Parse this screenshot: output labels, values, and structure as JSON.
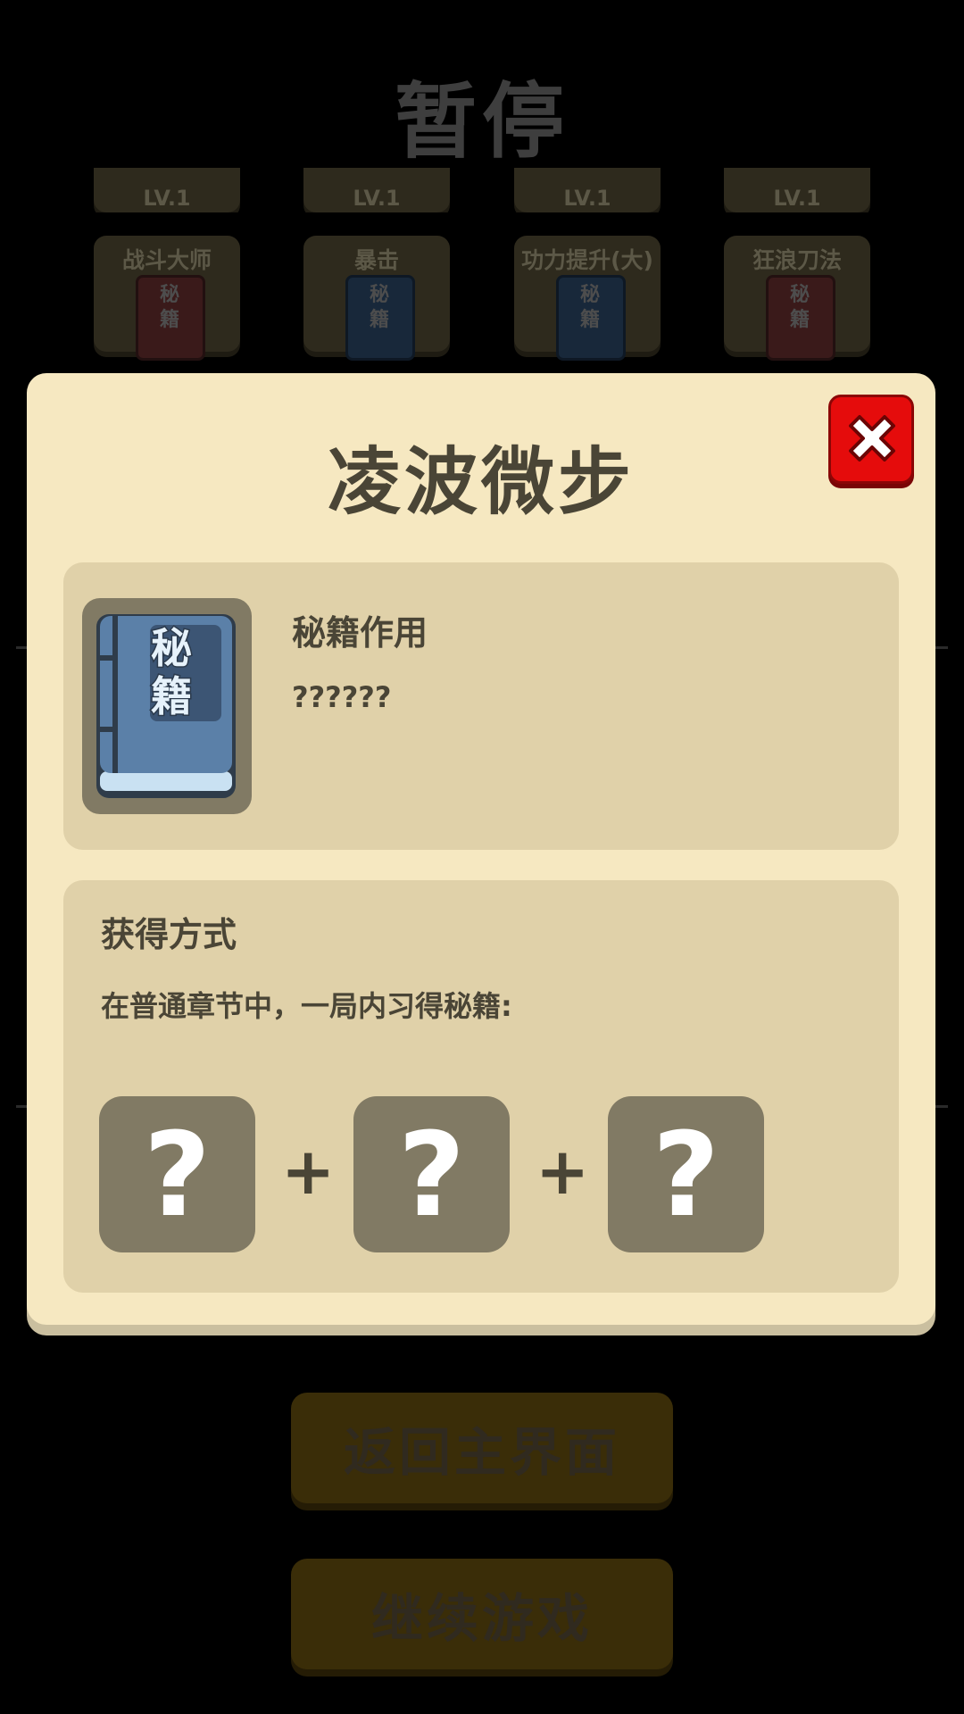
{
  "background": {
    "pause_title": "暂停",
    "top_row_levels": [
      "LV.1",
      "LV.1",
      "LV.1",
      "LV.1"
    ],
    "skills": [
      {
        "name": "战斗大师",
        "book_text": "秘籍",
        "color": "red"
      },
      {
        "name": "暴击",
        "book_text": "秘籍",
        "color": "blue"
      },
      {
        "name": "功力提升(大)",
        "book_text": "秘籍",
        "color": "blue"
      },
      {
        "name": "狂浪刀法",
        "book_text": "秘籍",
        "color": "red"
      }
    ],
    "buttons": {
      "return_main": "返回主界面",
      "continue_game": "继续游戏"
    }
  },
  "modal": {
    "title": "凌波微步",
    "close_icon": "close-x-icon",
    "book_icon_text": "秘籍",
    "effect_heading": "秘籍作用",
    "effect_text": "??????",
    "obtain_heading": "获得方式",
    "obtain_text": "在普通章节中，一局内习得秘籍:",
    "slots": [
      "?",
      "?",
      "?"
    ],
    "plus_sign": "+"
  },
  "colors": {
    "modal_bg": "#f6e8c1",
    "panel_bg": "#e0d1a9",
    "slot_bg": "#817a64",
    "close_red": "#e50c0c",
    "book_blue": "#5b80a8"
  }
}
